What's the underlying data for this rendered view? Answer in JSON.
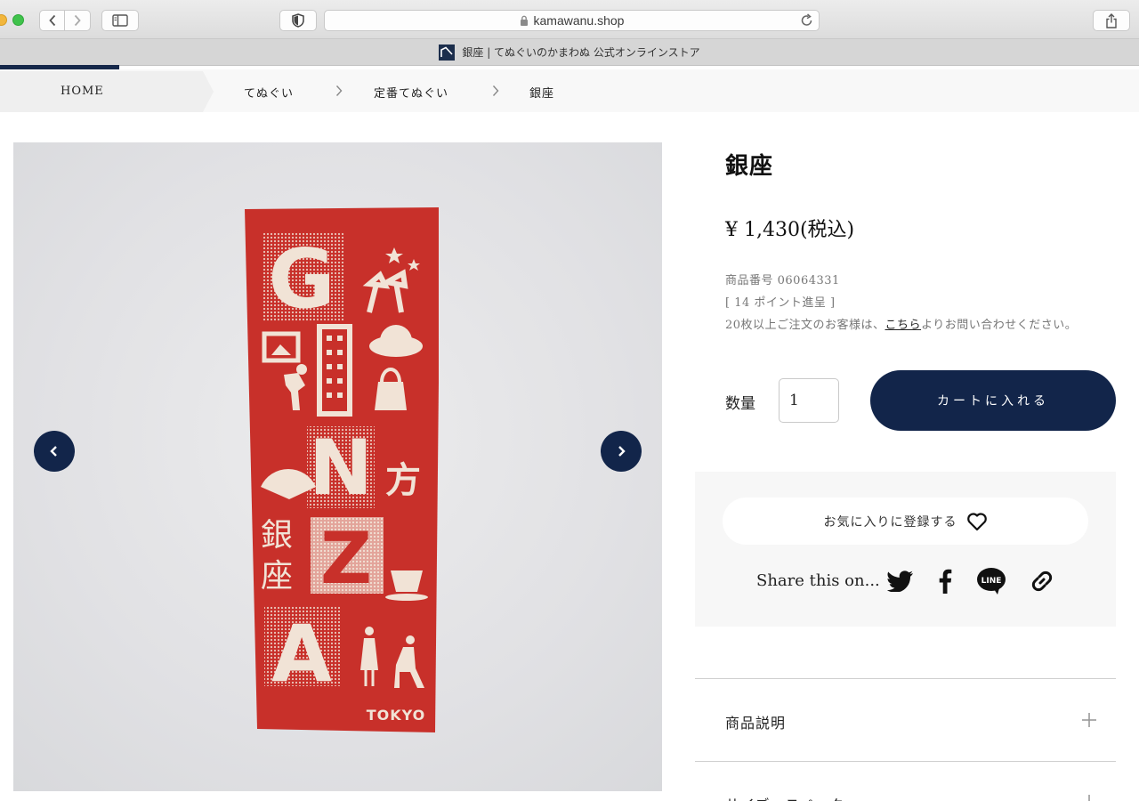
{
  "browser": {
    "url": "kamawanu.shop",
    "tab_title": "銀座 | てぬぐいのかまわぬ 公式オンラインストア"
  },
  "breadcrumb": {
    "items": [
      "HOME",
      "てぬぐい",
      "定番てぬぐい",
      "銀座"
    ]
  },
  "product": {
    "title": "銀座",
    "price": "¥ 1,430(税込)",
    "sku": "商品番号 06064331",
    "points": "[ 14 ポイント進呈 ]",
    "bulk_prefix": "20枚以上ご注文のお客様は、",
    "bulk_link": "こちら",
    "bulk_suffix": "よりお問い合わせください。",
    "quantity_label": "数量",
    "quantity_value": "1",
    "add_to_cart": "カートに入れる",
    "favorite": "お気に入りに登録する",
    "share_label": "Share this on...",
    "line_label": "LINE"
  },
  "towel_art": {
    "letters": [
      "G",
      "N",
      "Z",
      "A"
    ],
    "vertical_kanji": [
      "銀",
      "座"
    ],
    "kanji_mark": "方",
    "brand_mark": "TOKYO"
  },
  "accordion": [
    {
      "title": "商品説明"
    },
    {
      "title": "サイズ・スペック"
    }
  ],
  "colors": {
    "navy": "#12254a",
    "towel_red": "#c8302a",
    "towel_ink": "#f1e3d6"
  }
}
